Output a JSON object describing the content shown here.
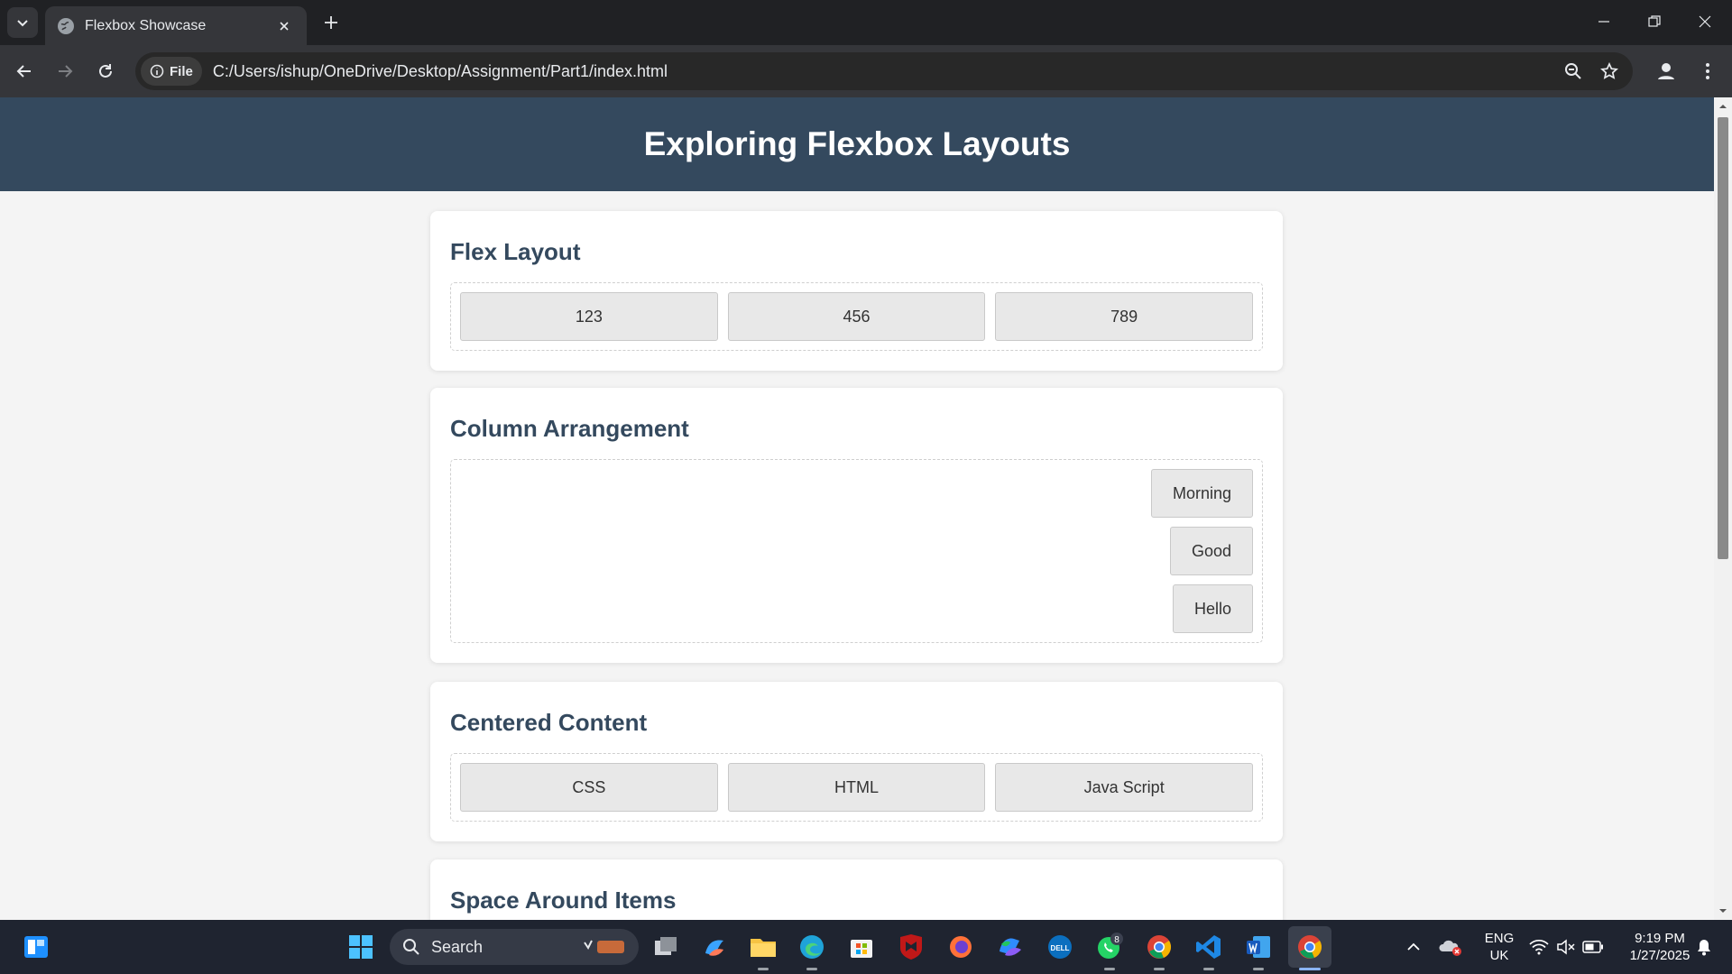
{
  "browser": {
    "tab_title": "Flexbox Showcase",
    "url_chip": "File",
    "url": "C:/Users/ishup/OneDrive/Desktop/Assignment/Part1/index.html"
  },
  "page": {
    "title": "Exploring Flexbox Layouts",
    "sections": [
      {
        "heading": "Flex Layout",
        "items": [
          "123",
          "456",
          "789"
        ]
      },
      {
        "heading": "Column Arrangement",
        "items": [
          "Morning",
          "Good",
          "Hello"
        ]
      },
      {
        "heading": "Centered Content",
        "items": [
          "CSS",
          "HTML",
          "Java Script"
        ]
      },
      {
        "heading": "Space Around Items",
        "items": []
      }
    ]
  },
  "taskbar": {
    "search_label": "Search",
    "whatsapp_badge": "8",
    "lang_line1": "ENG",
    "lang_line2": "UK",
    "time": "9:19 PM",
    "date": "1/27/2025"
  },
  "colors": {
    "header_bg": "#34495e",
    "page_bg": "#f4f4f4",
    "heading_text": "#34495e",
    "item_bg": "#e8e8e8"
  }
}
